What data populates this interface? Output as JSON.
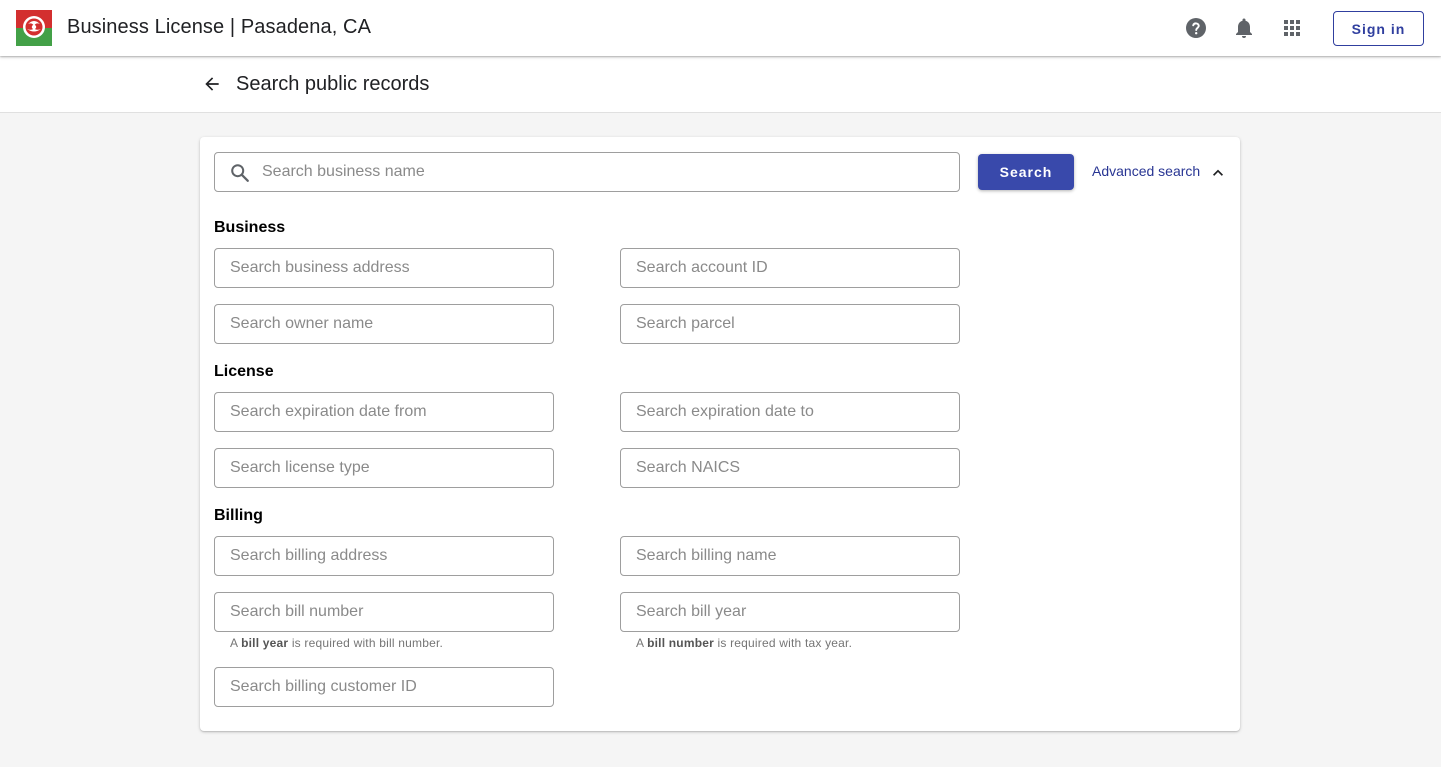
{
  "app": {
    "title": "Business License | Pasadena, CA",
    "logo_name": "pasadena-rose-logo",
    "colors": {
      "logo_red": "#d32f2f",
      "logo_green": "#43a047",
      "primary": "#3949ab",
      "link": "#283593"
    }
  },
  "topbar": {
    "icons": [
      "help-icon",
      "bell-icon",
      "apps-grid-icon"
    ],
    "signin_label": "Sign in"
  },
  "subheader": {
    "back_icon": "arrow-back-icon",
    "title": "Search public records"
  },
  "search": {
    "placeholder": "Search business name",
    "button_label": "Search",
    "advanced_label": "Advanced search",
    "advanced_icon": "chevron-up-icon"
  },
  "sections": {
    "business": {
      "label": "Business",
      "address_placeholder": "Search business address",
      "account_placeholder": "Search account ID",
      "owner_placeholder": "Search owner name",
      "parcel_placeholder": "Search parcel"
    },
    "license": {
      "label": "License",
      "exp_from_placeholder": "Search expiration date from",
      "exp_to_placeholder": "Search expiration date to",
      "type_placeholder": "Search license type",
      "naics_placeholder": "Search NAICS"
    },
    "billing": {
      "label": "Billing",
      "address_placeholder": "Search billing address",
      "name_placeholder": "Search billing name",
      "bill_number_placeholder": "Search bill number",
      "bill_year_placeholder": "Search bill year",
      "customer_id_placeholder": "Search billing customer ID",
      "hint_number": {
        "pre": "A",
        "bold": "bill year",
        "post": "is required with bill number."
      },
      "hint_year": {
        "pre": "A",
        "bold": "bill number",
        "post": "is required with tax year."
      }
    }
  }
}
